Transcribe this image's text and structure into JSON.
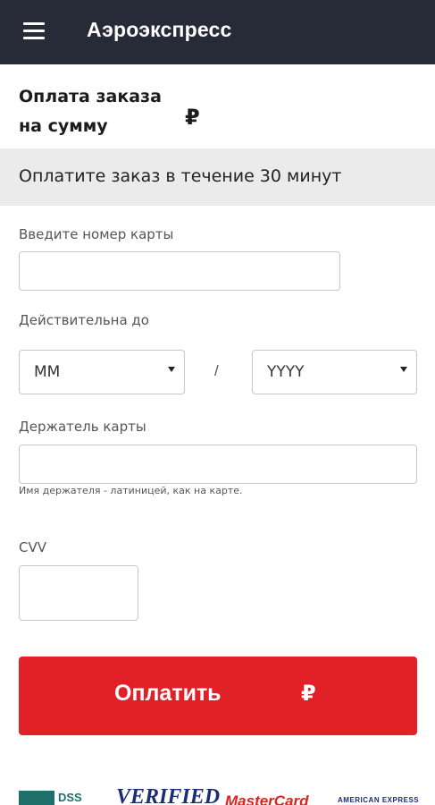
{
  "header": {
    "title": "Аэроэкспресс",
    "menu_icon": "hamburger-menu-icon"
  },
  "order": {
    "title_line1": "Оплата заказа",
    "title_line2": "на сумму",
    "currency": "₽"
  },
  "notice": {
    "text": "Оплатите заказ в течение 30 минут"
  },
  "form": {
    "card_number_label": "Введите номер карты",
    "card_number_value": "",
    "valid_until_label": "Действительна до",
    "month_select": "MM",
    "separator": "/",
    "year_select": "YYYY",
    "holder_label": "Держатель карты",
    "holder_value": "",
    "holder_hint": "Имя держателя - латиницей, как на карте.",
    "cvv_label": "CVV",
    "cvv_value": ""
  },
  "pay_button": {
    "label": "Оплатить",
    "currency": "₽",
    "color": "#e12127"
  },
  "logos": {
    "pci": "DSS",
    "visa": "VERIFIED",
    "mastercard": "MasterCard",
    "amex": "AMERICAN EXPRESS"
  },
  "colors": {
    "header_bg": "#272b38",
    "notice_bg": "#ebebeb",
    "accent": "#e12127"
  }
}
